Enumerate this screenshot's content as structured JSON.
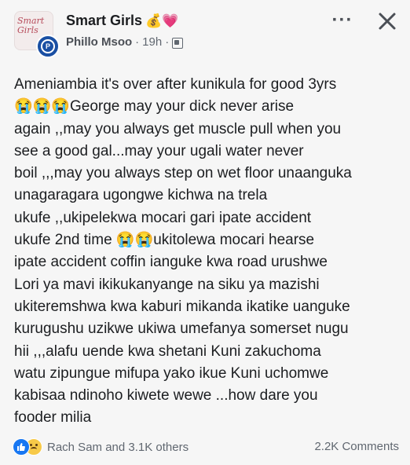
{
  "header": {
    "group_name": "Smart Girls",
    "group_emojis": "💰💗",
    "avatar_script": "Smart Girls",
    "author": "Phillo Msoo",
    "separator": "·",
    "time": "19h",
    "more_label": "···",
    "close_label": "✕"
  },
  "post": {
    "text": "Ameniambia it's over after kunikula for good 3yrs\n😭😭😭George may your dick never arise\nagain ,,may you always get muscle pull when you\nsee a good gal...may your ugali water never\nboil ,,,may you always step on wet floor unaanguka\nunagaragara ugongwe kichwa na trela\nukufe ,,ukipelekwa mocari gari ipate accident\nukufe 2nd time 😭😭ukitolewa mocari hearse\nipate accident coffin ianguke kwa road urushwe\nLori ya mavi ikikukanyange na siku ya mazishi\nukiteremshwa kwa kaburi mikanda ikatike uanguke\nkurugushu uzikwe ukiwa umefanya somerset nugu\nhii ,,,alafu uende kwa shetani Kuni zakuchoma\nwatu zipungue mifupa yako ikue Kuni uchomwe\nkabisaa ndinoho kiwete wewe ...how dare you\nfooder milia"
  },
  "footer": {
    "reactions": "Rach Sam and 3.1K others",
    "comments": "2.2K Comments"
  },
  "icons": {
    "like": "thumbs-up-icon",
    "sad": "sad-face-icon",
    "privacy": "group-privacy-icon",
    "close": "close-icon",
    "more": "more-options-icon"
  }
}
